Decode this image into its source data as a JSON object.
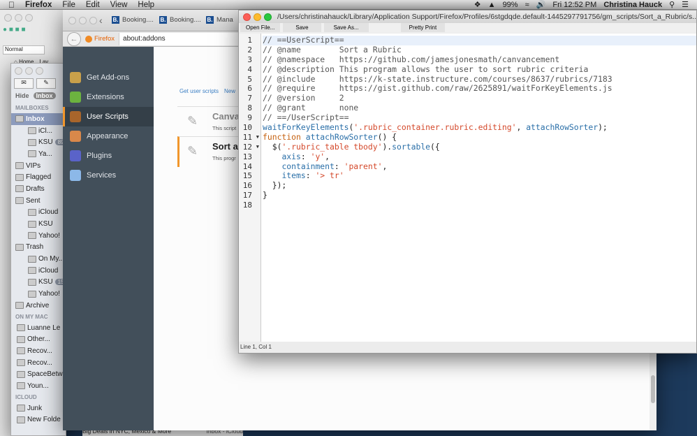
{
  "menubar": {
    "app": "Firefox",
    "items": [
      "File",
      "Edit",
      "View",
      "Help"
    ],
    "battery": "99%",
    "clock": "Fri 12:52 PM",
    "user": "Christina Hauck"
  },
  "mail": {
    "style_select": "Normal",
    "home_tab": "Home",
    "layout_tab": "Lay",
    "hide": "Hide",
    "inbox_tab": "Inbox",
    "mailboxes_header": "MAILBOXES",
    "mailboxes": [
      {
        "label": "Inbox",
        "selected": true
      },
      {
        "label": "iCl...",
        "indent": true
      },
      {
        "label": "KSU",
        "indent": true,
        "badge": "89"
      },
      {
        "label": "Ya...",
        "indent": true
      },
      {
        "label": "VIPs"
      },
      {
        "label": "Flagged"
      },
      {
        "label": "Drafts"
      },
      {
        "label": "Sent"
      },
      {
        "label": "iCloud",
        "indent": true
      },
      {
        "label": "KSU",
        "indent": true
      },
      {
        "label": "Yahoo!",
        "indent": true
      },
      {
        "label": "Trash"
      },
      {
        "label": "On My...",
        "indent": true
      },
      {
        "label": "iCloud",
        "indent": true
      },
      {
        "label": "KSU",
        "indent": true,
        "badge": "15"
      },
      {
        "label": "Yahoo!",
        "indent": true
      },
      {
        "label": "Archive"
      }
    ],
    "onmymac_header": "ON MY MAC",
    "onmymac": [
      "Luanne Le",
      "Other...",
      "Recov...",
      "Recov...",
      "SpaceBetw",
      "Youn..."
    ],
    "icloud_header": "ICLOUD",
    "icloud": [
      "Junk",
      "New Folde"
    ],
    "message_subject": "Big Deals in NYC, Mexico & More",
    "message_mailbox": "Inbox - iCloud"
  },
  "firefox": {
    "tabs": [
      "Booking....",
      "Booking....",
      "Mana"
    ],
    "identity": "Firefox",
    "url": "about:addons",
    "sidebar": [
      {
        "label": "Get Add-ons",
        "color": "#c9a04a"
      },
      {
        "label": "Extensions",
        "color": "#6cb33f"
      },
      {
        "label": "User Scripts",
        "color": "#a8652b",
        "selected": true
      },
      {
        "label": "Appearance",
        "color": "#d9884a"
      },
      {
        "label": "Plugins",
        "color": "#5a63c9"
      },
      {
        "label": "Services",
        "color": "#8cb8e8"
      }
    ],
    "links": [
      "Get user scripts",
      "New"
    ],
    "scripts": [
      {
        "name": "Canva",
        "desc": "This script"
      },
      {
        "name": "Sort a",
        "desc": "This progr"
      }
    ]
  },
  "editor": {
    "title": "/Users/christinahauck/Library/Application Support/Firefox/Profiles/6stgdqde.default-1445297791756/gm_scripts/Sort_a_Rubric/s...",
    "toolbar": [
      "Open File...",
      "Save",
      "Save As...",
      "Pretty Print"
    ],
    "status": "Line 1, Col 1",
    "folds": [
      11,
      12
    ],
    "lines": [
      [
        [
          "// ==UserScript==",
          "c"
        ]
      ],
      [
        [
          "// @name        Sort a Rubric",
          "c"
        ]
      ],
      [
        [
          "// @namespace   https://github.com/jamesjonesmath/canvancement",
          "c"
        ]
      ],
      [
        [
          "// @description This program allows the user to sort rubric criteria",
          "c"
        ]
      ],
      [
        [
          "// @include     https://k-state.instructure.com/courses/8637/rubrics/7183",
          "c"
        ]
      ],
      [
        [
          "// @require     https://gist.github.com/raw/2625891/waitForKeyElements.js",
          "c"
        ]
      ],
      [
        [
          "// @version     2",
          "c"
        ]
      ],
      [
        [
          "// @grant       none",
          "c"
        ]
      ],
      [
        [
          "// ==/UserScript==",
          "c"
        ]
      ],
      [
        [
          "waitForKeyElements",
          "f"
        ],
        [
          "(",
          "p"
        ],
        [
          "'.rubric_container.rubric.editing'",
          "s"
        ],
        [
          ", ",
          "p"
        ],
        [
          "attachRowSorter",
          "f"
        ],
        [
          ");",
          "p"
        ]
      ],
      [
        [
          "function",
          "k"
        ],
        [
          " ",
          "p"
        ],
        [
          "attachRowSorter",
          "f"
        ],
        [
          "() {",
          "p"
        ]
      ],
      [
        [
          "  $(",
          "p"
        ],
        [
          "'.rubric_table tbody'",
          "s"
        ],
        [
          ").",
          "p"
        ],
        [
          "sortable",
          "f"
        ],
        [
          "({",
          "p"
        ]
      ],
      [
        [
          "    ",
          "p"
        ],
        [
          "axis",
          "f"
        ],
        [
          ": ",
          "p"
        ],
        [
          "'y'",
          "s"
        ],
        [
          ",",
          "p"
        ]
      ],
      [
        [
          "    ",
          "p"
        ],
        [
          "containment",
          "f"
        ],
        [
          ": ",
          "p"
        ],
        [
          "'parent'",
          "s"
        ],
        [
          ",",
          "p"
        ]
      ],
      [
        [
          "    ",
          "p"
        ],
        [
          "items",
          "f"
        ],
        [
          ": ",
          "p"
        ],
        [
          "'> tr'",
          "s"
        ]
      ],
      [
        [
          "  });",
          "p"
        ]
      ],
      [
        [
          "}",
          "p"
        ]
      ],
      [
        [
          "",
          "p"
        ]
      ]
    ]
  }
}
